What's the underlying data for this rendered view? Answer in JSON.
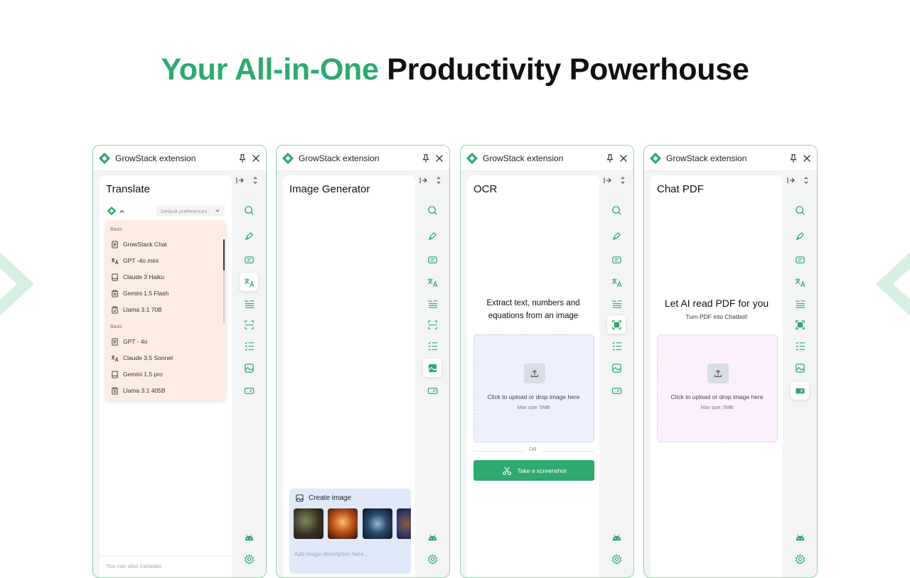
{
  "headline": {
    "part1": "Your All-in-One",
    "part2": "Productivity Powerhouse"
  },
  "colors": {
    "brand_green": "#2eaa6e",
    "panel_border": "#8fd3b1"
  },
  "extension_title": "GrowStack extension",
  "header_icons": [
    "pin-icon",
    "close-icon"
  ],
  "rail_icons": [
    "search-icon",
    "pen-icon",
    "chat-icon",
    "translate-icon",
    "quote-list-icon",
    "scan-icon",
    "checklist-icon",
    "image-icon",
    "ticket-icon",
    "android-icon",
    "settings-icon"
  ],
  "panels": {
    "translate": {
      "title": "Translate",
      "preference": "Default preferences",
      "groups": [
        {
          "label": "Basic",
          "items": [
            "GrowStack Chat",
            "GPT -4o mini",
            "Claude 3 Haiku",
            "Gemini 1.5 Flash",
            "Llama 3.1 70B"
          ]
        },
        {
          "label": "Basic",
          "items": [
            "GPT - 4o",
            "Claude 3.5 Sonnet",
            "Gemini 1.5 pro",
            "Llama 3.1 405B"
          ]
        }
      ],
      "footer": "You can also translate"
    },
    "image_generator": {
      "title": "Image Generator",
      "create_label": "Create image",
      "placeholder": "Add image description here..."
    },
    "ocr": {
      "title": "OCR",
      "headline_line1": "Extract text, numbers and",
      "headline_line2": "equations from an image",
      "upload_text": "Click to upload or drop image here",
      "max_size": "Max size: 5MB",
      "or": "OR",
      "screenshot_button": "Take a screenshot"
    },
    "chat_pdf": {
      "title": "Chat PDF",
      "headline": "Let AI read PDF for you",
      "subline": "Turn PDF into Chatbot!",
      "upload_text": "Click to upload or drop image here",
      "max_size": "Max size: 5MB"
    }
  }
}
